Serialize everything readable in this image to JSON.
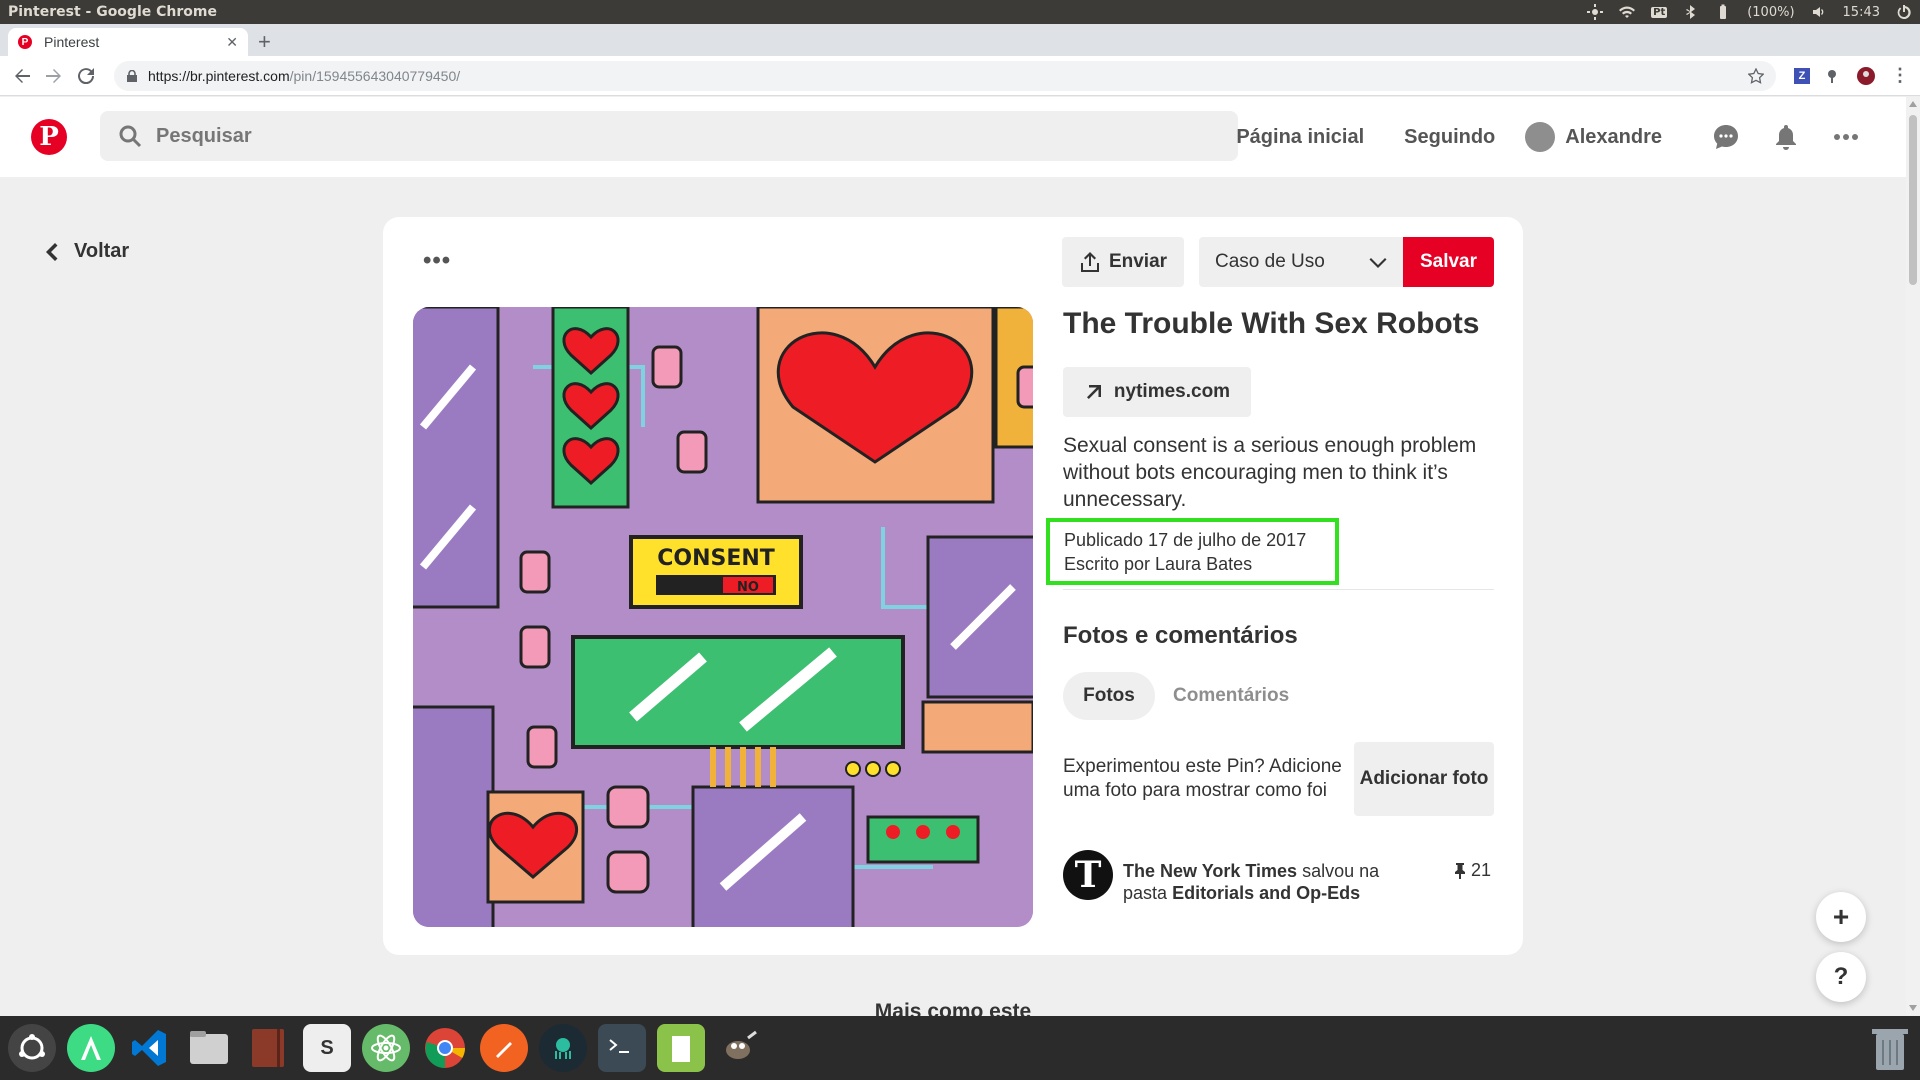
{
  "os": {
    "window_title": "Pinterest - Google Chrome",
    "keyboard": "Pt",
    "battery": "(100%)",
    "clock": "15:43"
  },
  "browser": {
    "tab_title": "Pinterest",
    "url_host": "https://br.pinterest.com",
    "url_path": "/pin/159455643040779450/"
  },
  "header": {
    "search_placeholder": "Pesquisar",
    "nav_home": "Página inicial",
    "nav_following": "Seguindo",
    "user_name": "Alexandre"
  },
  "back_label": "Voltar",
  "pin": {
    "send_label": "Enviar",
    "board_name": "Caso de Uso",
    "save_label": "Salvar",
    "title": "The Trouble With Sex Robots",
    "source": "nytimes.com",
    "description": "Sexual consent is a serious enough problem without bots encouraging men to think it’s unnecessary.",
    "published": "Publicado 17 de julho de 2017",
    "author": "Escrito por Laura Bates",
    "image_sign_top": "CONSENT",
    "image_sign_bottom": "NO"
  },
  "photos": {
    "section_title": "Fotos e comentários",
    "tab_photos": "Fotos",
    "tab_comments": "Comentários",
    "prompt": "Experimentou este Pin? Adicione uma foto para mostrar como foi",
    "add_photo": "Adicionar foto"
  },
  "saved_by": {
    "avatar_letter": "T",
    "name": "The New York Times",
    "verb": "salvou na pasta",
    "board": "Editorials and Op-Eds",
    "pin_count": "21"
  },
  "floating": {
    "plus": "+",
    "help": "?"
  },
  "more_like_this": "Mais como este",
  "colors": {
    "pinterest_red": "#e60023",
    "highlight_green": "#33e01f"
  }
}
